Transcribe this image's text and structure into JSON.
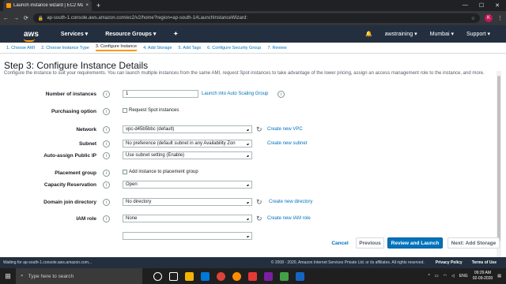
{
  "browser": {
    "tab_title": "Launch instance wizard | EC2 Ma",
    "tab_close": "×",
    "new_tab": "+",
    "url": "ap-south-1.console.aws.amazon.com/ec2/v2/home?region=ap-south-1#LaunchInstanceWizard:",
    "avatar_letter": "K"
  },
  "aws_nav": {
    "logo": "aws",
    "services": "Services",
    "resource_groups": "Resource Groups",
    "account": "awstraining",
    "region": "Mumbai",
    "support": "Support"
  },
  "wizard_steps": [
    "1. Choose AMI",
    "2. Choose Instance Type",
    "3. Configure Instance",
    "4. Add Storage",
    "5. Add Tags",
    "6. Configure Security Group",
    "7. Review"
  ],
  "page": {
    "title": "Step 3: Configure Instance Details",
    "description": "Configure the instance to suit your requirements. You can launch multiple instances from the same AMI, request Spot instances to take advantage of the lower pricing, assign an access management role to the instance, and more."
  },
  "form": {
    "num_instances_label": "Number of instances",
    "num_instances_value": "1",
    "asg_link": "Launch into Auto Scaling Group",
    "purchasing_label": "Purchasing option",
    "spot_checkbox": "Request Spot instances",
    "network_label": "Network",
    "network_value": "vpc-d45b5bbc (default)",
    "create_vpc": "Create new VPC",
    "subnet_label": "Subnet",
    "subnet_value": "No preference (default subnet in any Availability Zon",
    "create_subnet": "Create new subnet",
    "public_ip_label": "Auto-assign Public IP",
    "public_ip_value": "Use subnet setting (Enable)",
    "placement_label": "Placement group",
    "placement_checkbox": "Add instance to placement group",
    "capacity_label": "Capacity Reservation",
    "capacity_value": "Open",
    "domain_label": "Domain join directory",
    "domain_value": "No directory",
    "create_directory": "Create new directory",
    "iam_label": "IAM role",
    "iam_value": "None",
    "create_iam": "Create new IAM role"
  },
  "buttons": {
    "cancel": "Cancel",
    "previous": "Previous",
    "review_launch": "Review and Launch",
    "next": "Next: Add Storage"
  },
  "footer": {
    "status_url": "Waiting for ap-south-1.console.aws.amazon.com...",
    "copyright": "© 2008 - 2020, Amazon Internet Services Private Ltd. or its affiliates. All rights reserved.",
    "privacy": "Privacy Policy",
    "terms": "Terms of Use"
  },
  "taskbar": {
    "search_placeholder": "Type here to search",
    "lang": "ENG",
    "time": "09:29 AM",
    "date": "02-09-2020"
  },
  "colors": {
    "aws_orange": "#ff9900",
    "aws_navy": "#232f3e",
    "link_blue": "#0073bb"
  }
}
